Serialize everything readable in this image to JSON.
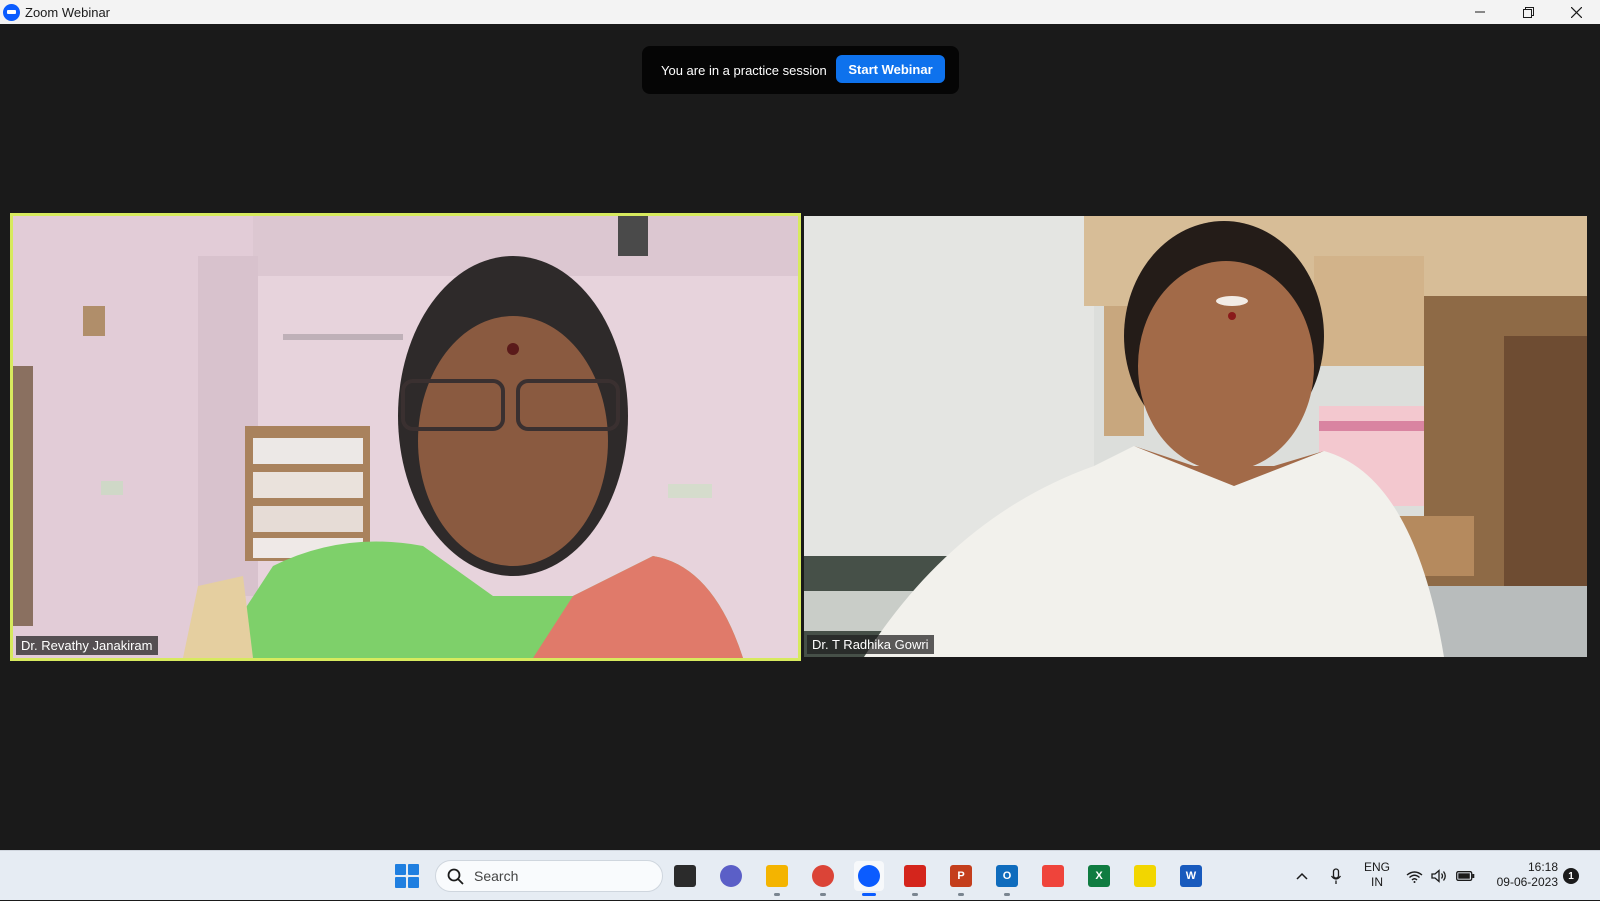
{
  "window": {
    "title": "Zoom Webinar"
  },
  "banner": {
    "text": "You are in a practice session",
    "start_label": "Start Webinar"
  },
  "participants": [
    {
      "name": "Dr. Revathy Janakiram",
      "active_speaker": true
    },
    {
      "name": "Dr. T Radhika Gowri",
      "active_speaker": false
    }
  ],
  "taskbar": {
    "search_placeholder": "Search",
    "apps": [
      {
        "name": "task-view",
        "color": "#2b2b2b"
      },
      {
        "name": "teams-chat",
        "color": "#5b5fc7"
      },
      {
        "name": "file-explorer",
        "color": "#f4b400"
      },
      {
        "name": "chrome",
        "color": "#db4437"
      },
      {
        "name": "zoom",
        "color": "#0b5cff"
      },
      {
        "name": "acrobat",
        "color": "#d4251c"
      },
      {
        "name": "powerpoint",
        "color": "#c43e1c"
      },
      {
        "name": "outlook",
        "color": "#0f6cbd"
      },
      {
        "name": "anydesk",
        "color": "#ef443b"
      },
      {
        "name": "excel",
        "color": "#107c41"
      },
      {
        "name": "sticky-notes",
        "color": "#f2d600"
      },
      {
        "name": "word",
        "color": "#185abd"
      }
    ],
    "lang_primary": "ENG",
    "lang_secondary": "IN",
    "time": "16:18",
    "date": "09-06-2023",
    "notification_count": "1"
  },
  "colors": {
    "accent": "#0e72ed",
    "active_speaker_border": "#d7ea5e",
    "zoom_brand": "#0b5cff"
  }
}
